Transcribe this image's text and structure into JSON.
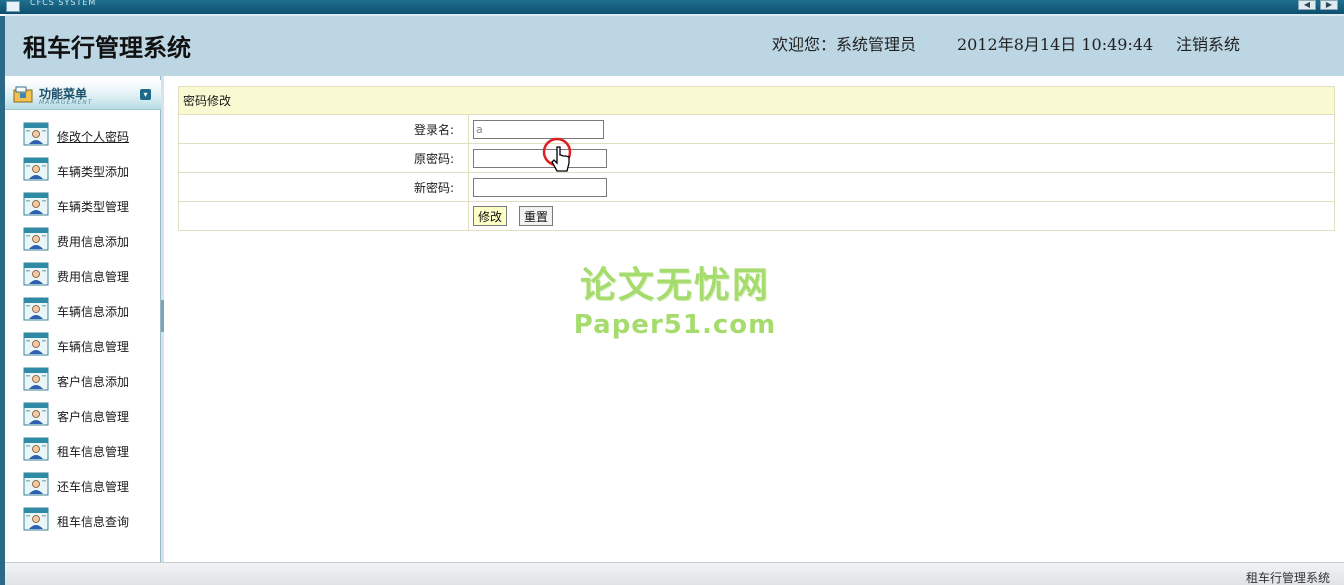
{
  "window": {
    "title": "CFCS SYSTEM",
    "controls": [
      "◀",
      "▶"
    ]
  },
  "header": {
    "title": "租车行管理系统",
    "welcome": "欢迎您：系统管理员",
    "datetime": "2012年8月14日  10:49:44",
    "logout": "注销系统"
  },
  "sidebar": {
    "title": "功能菜单",
    "subtitle": "MANAGEMENT",
    "items": [
      {
        "label": "修改个人密码",
        "active": true
      },
      {
        "label": "车辆类型添加"
      },
      {
        "label": "车辆类型管理"
      },
      {
        "label": "费用信息添加"
      },
      {
        "label": "费用信息管理"
      },
      {
        "label": "车辆信息添加"
      },
      {
        "label": "车辆信息管理"
      },
      {
        "label": "客户信息添加"
      },
      {
        "label": "客户信息管理"
      },
      {
        "label": "租车信息管理"
      },
      {
        "label": "还车信息管理"
      },
      {
        "label": "租车信息查询"
      }
    ],
    "item_icon": "user-card-icon"
  },
  "form": {
    "header": "密码修改",
    "login_label": "登录名:",
    "login_value": "a",
    "old_pwd_label": "原密码:",
    "old_pwd_value": "",
    "new_pwd_label": "新密码:",
    "new_pwd_value": "",
    "submit_label": "修改",
    "reset_label": "重置"
  },
  "watermark": {
    "cn": "论文无忧网",
    "en": "Paper51.com"
  },
  "footer": {
    "text": "租车行管理系统"
  },
  "colors": {
    "header_bg": "#bcd6e4",
    "frame": "#2a6a86",
    "form_header_bg": "#fafad2",
    "watermark": "#a6dc6e"
  }
}
